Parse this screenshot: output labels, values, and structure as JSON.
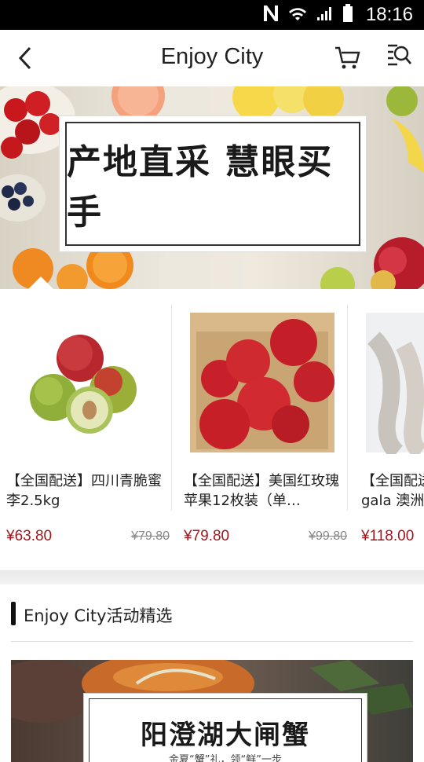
{
  "status_bar": {
    "time": "18:16"
  },
  "header": {
    "title": "Enjoy City"
  },
  "banner": {
    "text": "产地直采 慧眼买手"
  },
  "products": [
    {
      "name": "【全国配送】四川青脆蜜李2.5kg",
      "price": "¥63.80",
      "original_price": "¥79.80"
    },
    {
      "name": "【全国配送】美国红玫瑰苹果12枚装（单…",
      "price": "¥79.80",
      "original_price": "¥99.80"
    },
    {
      "name": "【全国配送】",
      "name_line2": "gala 澳洲",
      "price": "¥118.00"
    }
  ],
  "activities": {
    "title": "Enjoy City活动精选",
    "card_title": "阳澄湖大闸蟹",
    "card_sub": "金夏“蟹”礼，领“鲜”一步"
  },
  "colors": {
    "price": "#a3151c",
    "status_bar": "#000000"
  }
}
